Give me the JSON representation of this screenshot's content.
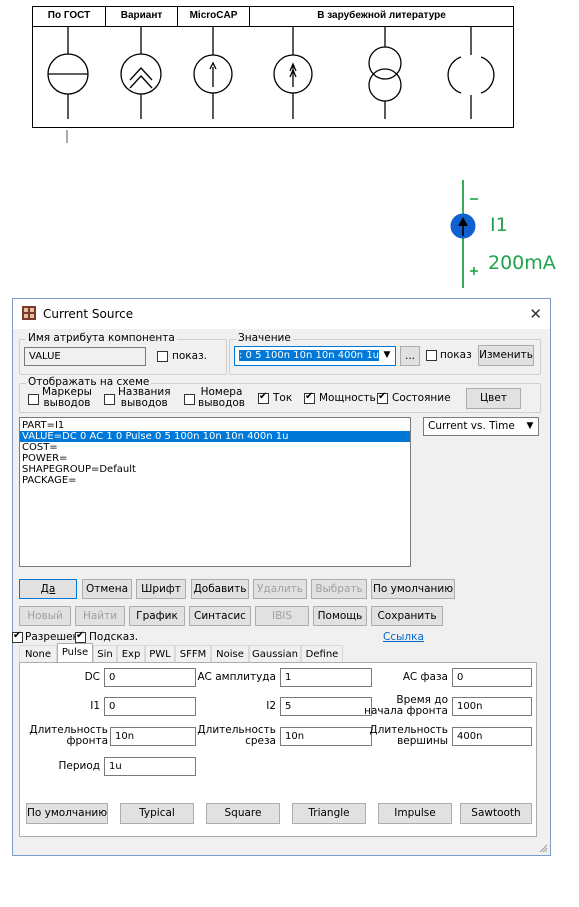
{
  "table": {
    "headers": [
      "По ГОСТ",
      "Вариант",
      "MicroCAP",
      "В зарубежной литературе"
    ]
  },
  "schematic": {
    "ref": "I1",
    "value": "200mA",
    "minus": "-",
    "plus": "+",
    "color": "#1ea34a",
    "fill": "#1060d0"
  },
  "dialog": {
    "title": "Current Source",
    "close": "✕",
    "attr_name_group": "Имя атрибута компонента",
    "attr_name_value": "VALUE",
    "attr_name_show": "показ.",
    "value_group": "Значение",
    "value_field": ": 0 5 100n 10n 10n 400n 1u",
    "ellipsis": "...",
    "value_show": "показ",
    "change_btn": "Изменить",
    "display_group": "Отображать на схеме",
    "display_opts": {
      "markers_1": "Маркеры",
      "markers_2": "выводов",
      "names_1": "Названия",
      "names_2": "выводов",
      "numbers_1": "Номера",
      "numbers_2": "выводов",
      "current": "Ток",
      "power": "Мощность",
      "state": "Состояние"
    },
    "color_btn": "Цвет",
    "attr_list": [
      "PART=I1",
      "VALUE=DC 0 AC 1 0 Pulse 0 5 100n 10n 10n 400n 1u",
      "COST=",
      "POWER=",
      "SHAPEGROUP=Default",
      "PACKAGE="
    ],
    "plot_select": "Current vs. Time",
    "buttons_row1": {
      "ok": "Да",
      "cancel": "Отмена",
      "font": "Шрифт",
      "add": "Добавить",
      "delete": "Удалить",
      "select": "Выбрать",
      "default": "По умолчанию"
    },
    "buttons_row2": {
      "new": "Новый",
      "find": "Найти",
      "plot": "График",
      "syntax": "Синтасис",
      "ibis": "IBIS",
      "help": "Помощь",
      "save": "Сохранить"
    },
    "enabled_label": "Разрешен",
    "hint_label": "Подсказ.",
    "link": "Ссылка",
    "tabs": [
      "None",
      "Pulse",
      "Sin",
      "Exp",
      "PWL",
      "SFFM",
      "Noise",
      "Gaussian",
      "Define"
    ],
    "params": {
      "dc_label": "DC",
      "dc_value": "0",
      "ac_amp_label": "AC амплитуда",
      "ac_amp_value": "1",
      "ac_phase_label": "AC фаза",
      "ac_phase_value": "0",
      "i1_label": "I1",
      "i1_value": "0",
      "i2_label": "I2",
      "i2_value": "5",
      "delay_label_1": "Время до",
      "delay_label_2": "начала фронта",
      "delay_value": "100n",
      "rise_label_1": "Длительность",
      "rise_label_2": "фронта",
      "rise_value": "10n",
      "fall_label_1": "Длительность",
      "fall_label_2": "среза",
      "fall_value": "10n",
      "width_label_1": "Длительность",
      "width_label_2": "вершины",
      "width_value": "400n",
      "period_label": "Период",
      "period_value": "1u"
    },
    "presets": [
      "По умолчанию",
      "Typical",
      "Square",
      "Triangle",
      "Impulse",
      "Sawtooth"
    ]
  }
}
